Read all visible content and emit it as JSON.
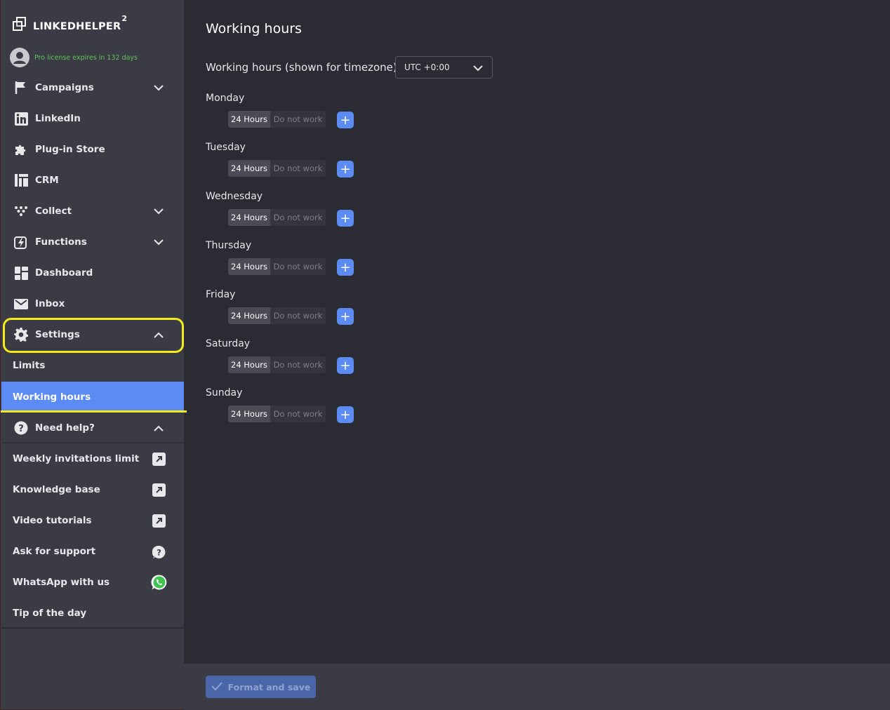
{
  "app": {
    "logo_text": "LINKEDHELPER",
    "logo_sup": "2",
    "license_text": "Pro license expires in 132 days"
  },
  "sidebar": {
    "items": [
      {
        "label": "Campaigns",
        "icon": "flag-icon",
        "chevron": "down"
      },
      {
        "label": "LinkedIn",
        "icon": "linkedin-icon"
      },
      {
        "label": "Plug-in Store",
        "icon": "puzzle-icon"
      },
      {
        "label": "CRM",
        "icon": "crm-icon"
      },
      {
        "label": "Collect",
        "icon": "collect-icon",
        "chevron": "down"
      },
      {
        "label": "Functions",
        "icon": "lightning-icon",
        "chevron": "down"
      },
      {
        "label": "Dashboard",
        "icon": "dashboard-icon"
      },
      {
        "label": "Inbox",
        "icon": "mail-icon"
      },
      {
        "label": "Settings",
        "icon": "gear-icon",
        "chevron": "up"
      }
    ],
    "settings_sub": [
      {
        "label": "Limits"
      },
      {
        "label": "Working hours",
        "active": true
      }
    ],
    "help": {
      "label": "Need help?",
      "icon": "question-icon",
      "items": [
        {
          "label": "Weekly invitations limit",
          "icon": "external-link-icon"
        },
        {
          "label": "Knowledge base",
          "icon": "external-link-icon"
        },
        {
          "label": "Video tutorials",
          "icon": "external-link-icon"
        },
        {
          "label": "Ask for support",
          "icon": "support-question-icon"
        },
        {
          "label": "WhatsApp with us",
          "icon": "whatsapp-icon"
        },
        {
          "label": "Tip of the day"
        }
      ]
    }
  },
  "main": {
    "title": "Working hours",
    "timezone_label": "Working hours (shown for timezone):",
    "timezone_value": "UTC +0:00",
    "days": [
      {
        "name": "Monday",
        "on_label": "24 Hours",
        "off_label": "Do not work",
        "selected": "24 Hours"
      },
      {
        "name": "Tuesday",
        "on_label": "24 Hours",
        "off_label": "Do not work",
        "selected": "24 Hours"
      },
      {
        "name": "Wednesday",
        "on_label": "24 Hours",
        "off_label": "Do not work",
        "selected": "24 Hours"
      },
      {
        "name": "Thursday",
        "on_label": "24 Hours",
        "off_label": "Do not work",
        "selected": "24 Hours"
      },
      {
        "name": "Friday",
        "on_label": "24 Hours",
        "off_label": "Do not work",
        "selected": "24 Hours"
      },
      {
        "name": "Saturday",
        "on_label": "24 Hours",
        "off_label": "Do not work",
        "selected": "24 Hours"
      },
      {
        "name": "Sunday",
        "on_label": "24 Hours",
        "off_label": "Do not work",
        "selected": "24 Hours"
      }
    ],
    "add_label": "+"
  },
  "footer": {
    "save_label": "Format and save",
    "save_disabled": true
  },
  "colors": {
    "accent": "#5b8bf3",
    "sidebar_bg": "#3a3b44",
    "main_bg": "#2b2c33",
    "license_green": "#5fc45a",
    "highlight": "#f2ea1c"
  }
}
